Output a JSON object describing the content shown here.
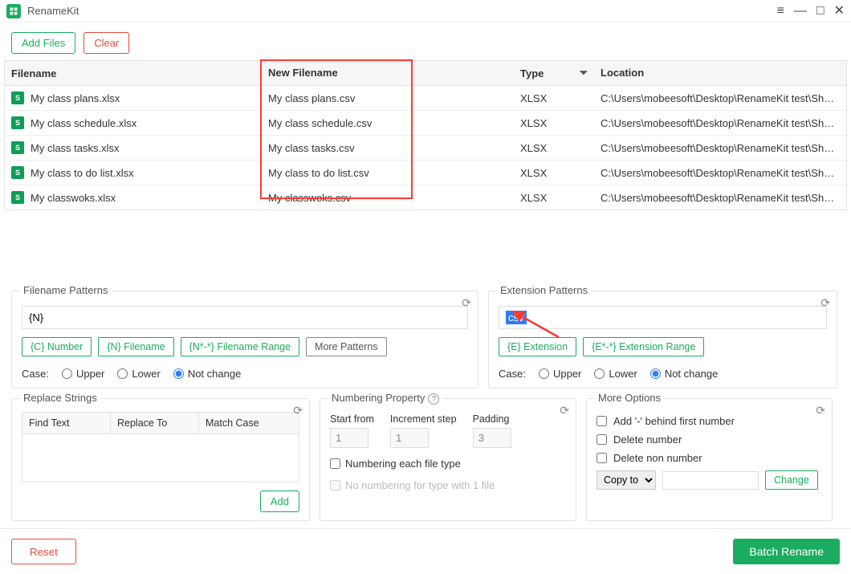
{
  "app": {
    "title": "RenameKit"
  },
  "toolbar": {
    "add_files": "Add Files",
    "clear": "Clear"
  },
  "table": {
    "headers": {
      "filename": "Filename",
      "new_filename": "New Filename",
      "type": "Type",
      "location": "Location"
    },
    "rows": [
      {
        "file": "My class plans.xlsx",
        "newfile": "My class plans.csv",
        "type": "XLSX",
        "loc": "C:\\Users\\mobeesoft\\Desktop\\RenameKit test\\Sheets"
      },
      {
        "file": "My class schedule.xlsx",
        "newfile": "My class schedule.csv",
        "type": "XLSX",
        "loc": "C:\\Users\\mobeesoft\\Desktop\\RenameKit test\\Sheets"
      },
      {
        "file": "My class tasks.xlsx",
        "newfile": "My class tasks.csv",
        "type": "XLSX",
        "loc": "C:\\Users\\mobeesoft\\Desktop\\RenameKit test\\Sheets"
      },
      {
        "file": "My class to do list.xlsx",
        "newfile": "My class to do list.csv",
        "type": "XLSX",
        "loc": "C:\\Users\\mobeesoft\\Desktop\\RenameKit test\\Sheets"
      },
      {
        "file": "My classwoks.xlsx",
        "newfile": "My classwoks.csv",
        "type": "XLSX",
        "loc": "C:\\Users\\mobeesoft\\Desktop\\RenameKit test\\Sheets"
      }
    ]
  },
  "filename_patterns": {
    "title": "Filename Patterns",
    "value": "{N}",
    "tags": {
      "number": "{C} Number",
      "filename": "{N} Filename",
      "range": "{N*-*} Filename Range",
      "more": "More Patterns"
    },
    "case_label": "Case:",
    "upper": "Upper",
    "lower": "Lower",
    "not_change": "Not change"
  },
  "extension_patterns": {
    "title": "Extension Patterns",
    "value": "csv",
    "tags": {
      "ext": "{E} Extension",
      "range": "{E*-*} Extension Range"
    },
    "case_label": "Case:",
    "upper": "Upper",
    "lower": "Lower",
    "not_change": "Not change"
  },
  "replace": {
    "title": "Replace Strings",
    "find": "Find Text",
    "to": "Replace To",
    "match": "Match Case",
    "add": "Add"
  },
  "numbering": {
    "title": "Numbering Property",
    "start": "Start from",
    "increment": "Increment step",
    "padding": "Padding",
    "start_val": "1",
    "increment_val": "1",
    "padding_val": "3",
    "each_type": "Numbering each file type",
    "no_numbering": "No numbering for type with 1 file"
  },
  "options": {
    "title": "More Options",
    "add_dash": "Add '-' behind first number",
    "delete_number": "Delete number",
    "delete_non_number": "Delete non number",
    "copy_to": "Copy to",
    "change": "Change"
  },
  "footer": {
    "reset": "Reset",
    "batch": "Batch Rename"
  }
}
